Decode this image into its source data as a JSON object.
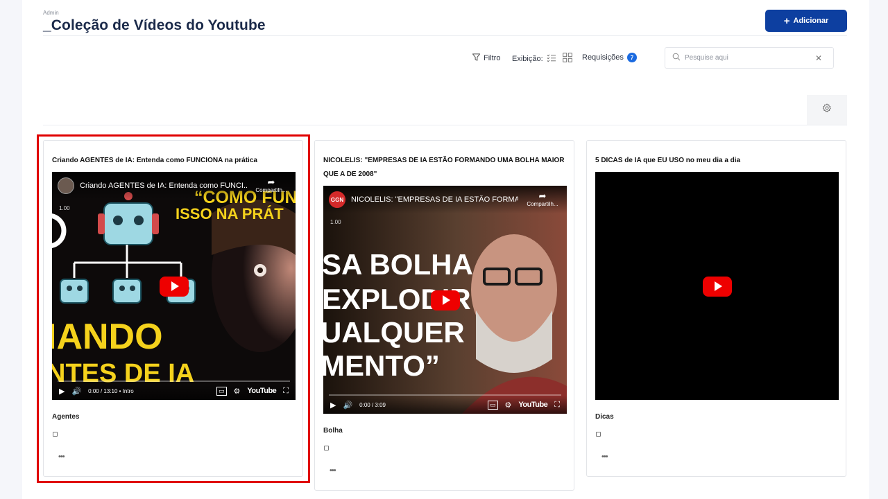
{
  "header": {
    "breadcrumb": "Admin",
    "title": "_Coleção de Vídeos do Youtube",
    "add_button": "Adicionar"
  },
  "toolbar": {
    "filter_label": "Filtro",
    "view_label": "Exibição:",
    "requests_label": "Requisições",
    "requests_count": "7",
    "search_placeholder": "Pesquise aqui"
  },
  "colors": {
    "primary": "#0d3fa0",
    "badge": "#1a6ae0",
    "highlight": "#e00000",
    "youtube_red": "#ee0000"
  },
  "cards": [
    {
      "title": "Criando AGENTES de IA: Entenda como FUNCIONA na prática",
      "tag": "Agentes",
      "video": {
        "title": "Criando AGENTES de IA: Entenda como FUNCI...",
        "share": "Compartilh...",
        "speed": "1.00",
        "time": "0:00 / 13:10 • Intro",
        "thumb_text_1": "“COMO FUNC",
        "thumb_text_2": "ISSO NA PRÁT",
        "thumb_text_3": "IANDO",
        "thumb_text_4": "NTES DE IA"
      },
      "more": "•••"
    },
    {
      "title": "NICOLELIS: \"EMPRESAS DE IA ESTÃO FORMANDO UMA BOLHA MAIOR QUE A DE 2008\"",
      "tag": "Bolha",
      "video": {
        "title": "NICOLELIS: \"EMPRESAS DE IA ESTÃO FORMA...",
        "share": "Compartilh...",
        "speed": "1.00",
        "time": "0:00 / 3:09",
        "channel": "GGN",
        "thumb_text_1": "SA BOLHA",
        "thumb_text_2": "EXPLODIR",
        "thumb_text_3": "UALQUER",
        "thumb_text_4": "MENTO”"
      },
      "more": "•••"
    },
    {
      "title": "5 DICAS de IA que EU USO no meu dia a dia",
      "tag": "Dicas",
      "more": "•••"
    }
  ],
  "youtube_label": "YouTube"
}
